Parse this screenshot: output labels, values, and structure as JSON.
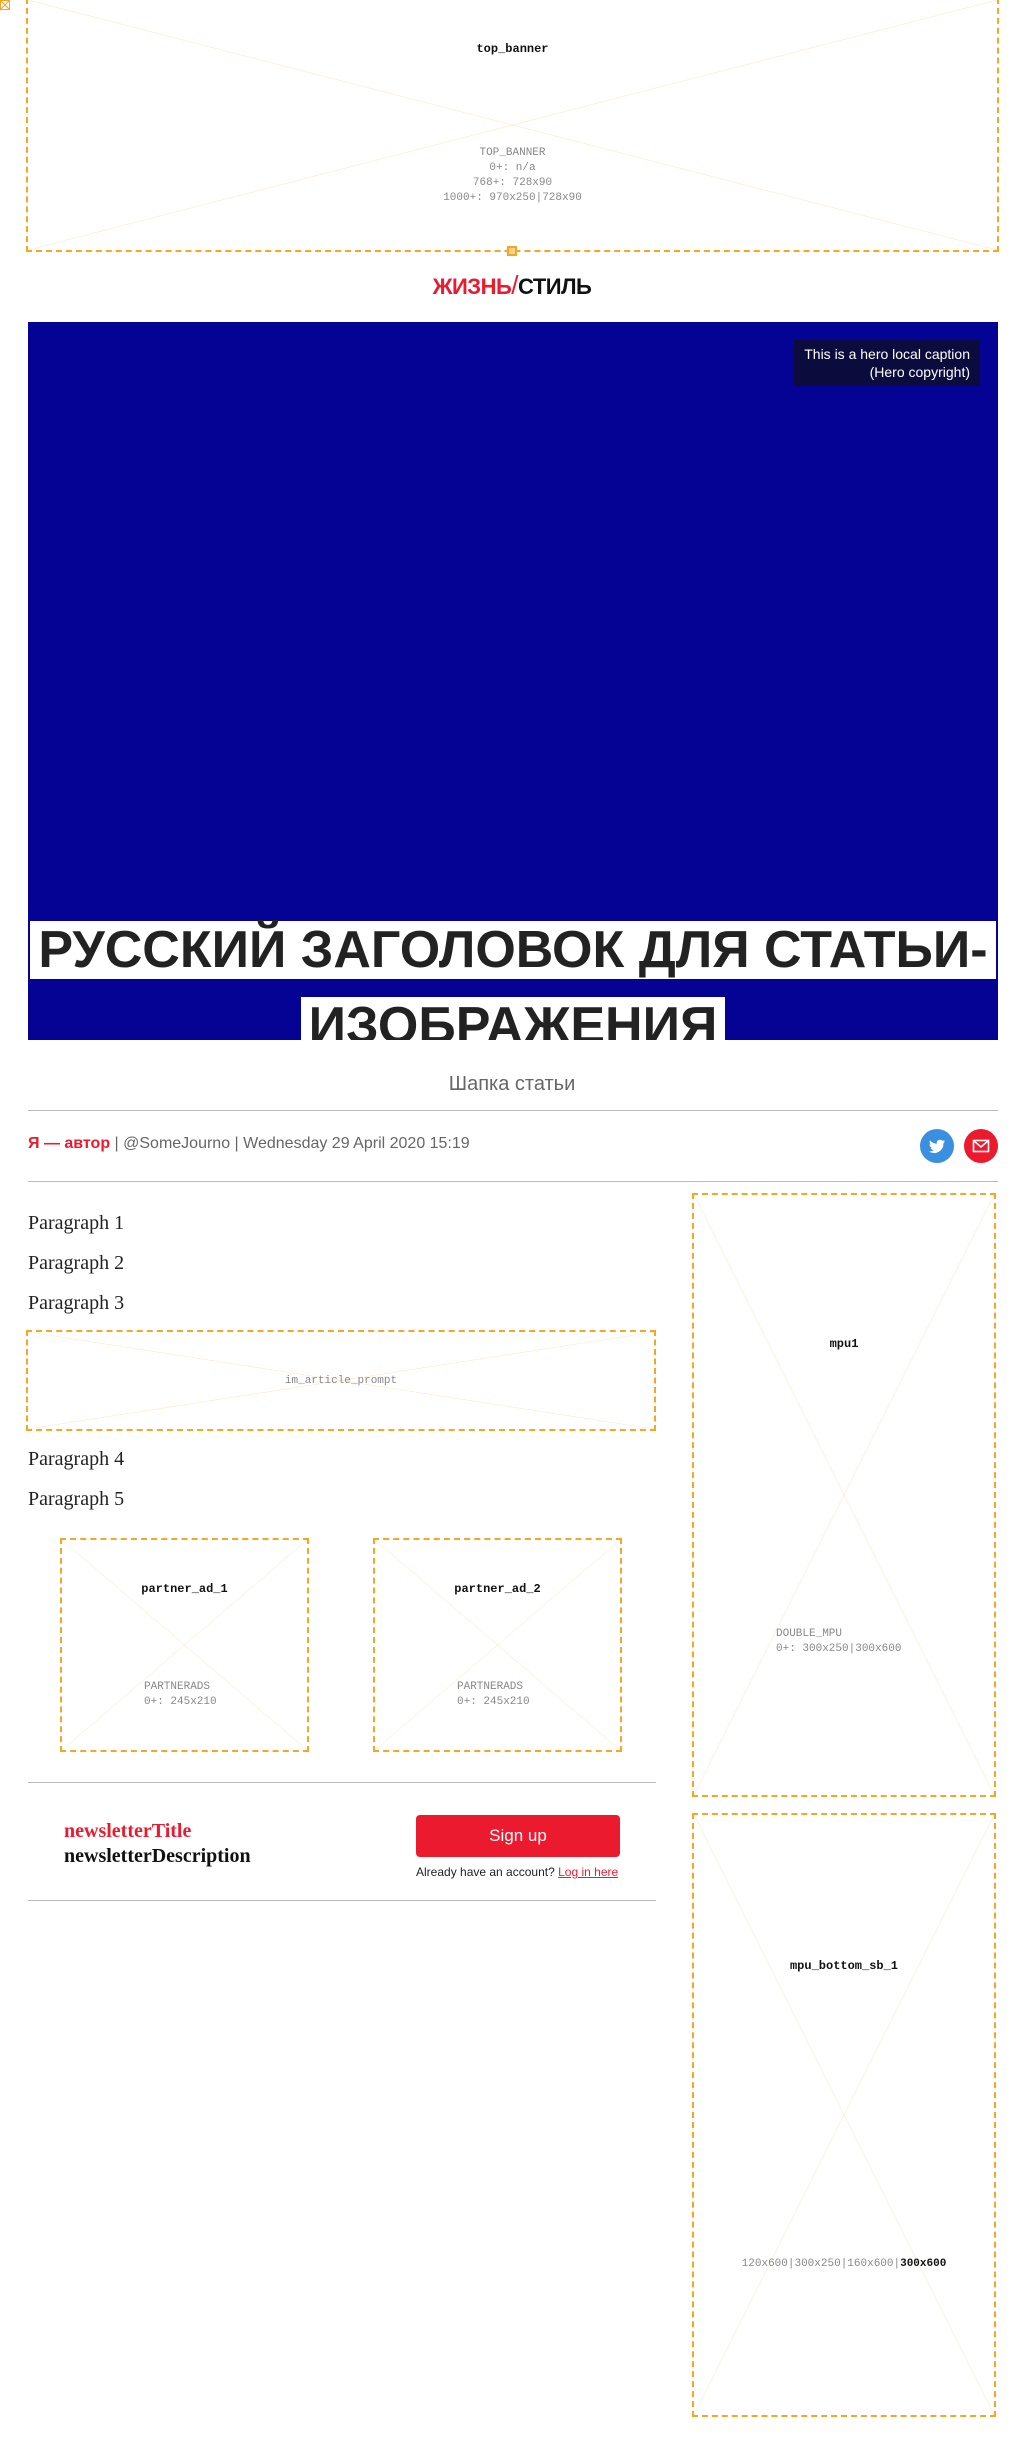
{
  "ads": {
    "top_banner": {
      "name": "top_banner",
      "info": [
        "TOP_BANNER",
        "0+: n/a",
        "768+: 728x90",
        "1000+: 970x250|728x90"
      ]
    },
    "im_article_prompt": {
      "info": "im_article_prompt"
    },
    "partner_ad_1": {
      "name": "partner_ad_1",
      "info": [
        "PARTNERADS",
        "0+: 245x210"
      ]
    },
    "partner_ad_2": {
      "name": "partner_ad_2",
      "info": [
        "PARTNERADS",
        "0+: 245x210"
      ]
    },
    "mpu1": {
      "name": "mpu1",
      "info": [
        "DOUBLE_MPU",
        "0+: 300x250|300x600"
      ]
    },
    "mpu_bottom_sb_1": {
      "name": "mpu_bottom_sb_1",
      "info_prefix": "120x600|300x250|160x600|",
      "info_highlight": "300x600"
    }
  },
  "logo": {
    "left": "ЖИЗНЬ",
    "slash": "/",
    "right": "СТИЛЬ"
  },
  "hero": {
    "caption_line1": "This is a hero local caption",
    "caption_line2": "(Hero copyright)",
    "headline": "РУССКИЙ ЗАГОЛОВОК ДЛЯ СТАТЬИ-ИЗОБРАЖЕНИЯ"
  },
  "standfirst": "Шапка статьи",
  "byline": {
    "author": "Я — автор",
    "separator": " | ",
    "twitter": "@SomeJourno",
    "date": "Wednesday 29 April 2020 15:19"
  },
  "social": {
    "twitter_icon": "twitter-icon",
    "email_icon": "email-icon"
  },
  "paragraphs": [
    "Paragraph 1",
    "Paragraph 2",
    "Paragraph 3",
    "Paragraph 4",
    "Paragraph 5"
  ],
  "newsletter": {
    "title": "newsletterTitle",
    "description": "newsletterDescription",
    "button_label": "Sign up",
    "login_prompt": "Already have an account?",
    "login_link": "Log in here"
  },
  "colors": {
    "accent": "#ec1a2e",
    "hero_bg": "#050394",
    "ad_outline": "#f5a623",
    "twitter": "#3b8fe0"
  }
}
